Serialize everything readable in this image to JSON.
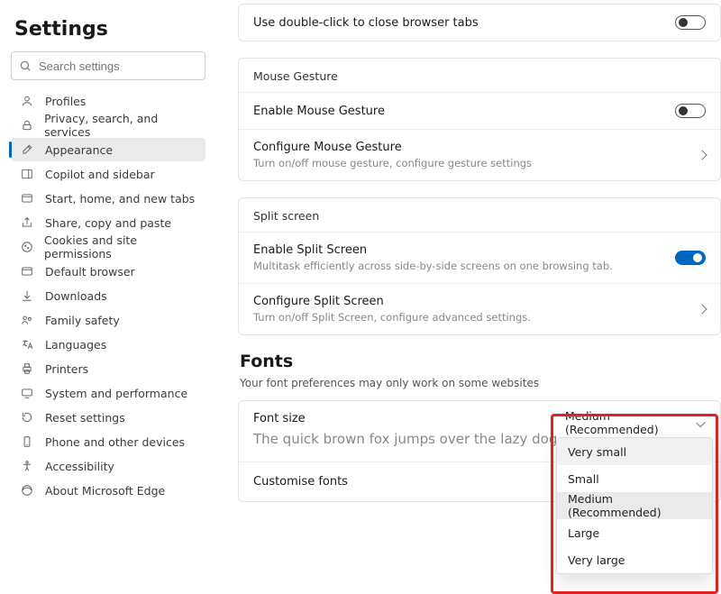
{
  "sidebar": {
    "title": "Settings",
    "search_placeholder": "Search settings",
    "items": [
      {
        "label": "Profiles"
      },
      {
        "label": "Privacy, search, and services"
      },
      {
        "label": "Appearance"
      },
      {
        "label": "Copilot and sidebar"
      },
      {
        "label": "Start, home, and new tabs"
      },
      {
        "label": "Share, copy and paste"
      },
      {
        "label": "Cookies and site permissions"
      },
      {
        "label": "Default browser"
      },
      {
        "label": "Downloads"
      },
      {
        "label": "Family safety"
      },
      {
        "label": "Languages"
      },
      {
        "label": "Printers"
      },
      {
        "label": "System and performance"
      },
      {
        "label": "Reset settings"
      },
      {
        "label": "Phone and other devices"
      },
      {
        "label": "Accessibility"
      },
      {
        "label": "About Microsoft Edge"
      }
    ]
  },
  "main": {
    "double_click": "Use double-click to close browser tabs",
    "mouse_gesture": {
      "header": "Mouse Gesture",
      "enable": "Enable Mouse Gesture",
      "configure": "Configure Mouse Gesture",
      "configure_desc": "Turn on/off mouse gesture, configure gesture settings"
    },
    "split_screen": {
      "header": "Split screen",
      "enable": "Enable Split Screen",
      "enable_desc": "Multitask efficiently across side-by-side screens on one browsing tab.",
      "configure": "Configure Split Screen",
      "configure_desc": "Turn on/off Split Screen, configure advanced settings."
    },
    "fonts": {
      "heading": "Fonts",
      "sub": "Your font preferences may only work on some websites",
      "fontsize_label": "Font size",
      "preview": "The quick brown fox jumps over the lazy dog",
      "customise": "Customise fonts",
      "dropdown": {
        "current": "Medium (Recommended)",
        "options": [
          "Very small",
          "Small",
          "Medium (Recommended)",
          "Large",
          "Very large"
        ]
      }
    }
  }
}
